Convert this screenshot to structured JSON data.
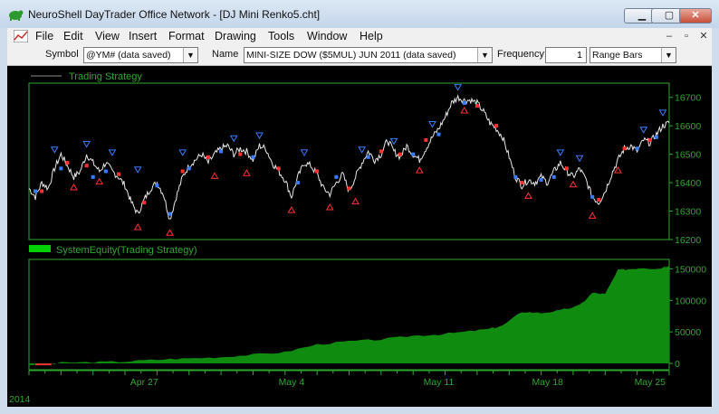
{
  "window": {
    "title": "NeuroShell DayTrader Office Network - [DJ Mini Renko5.cht]",
    "minimize": "▁",
    "maximize": "▢",
    "close": "✕"
  },
  "menu": {
    "items": [
      "File",
      "Edit",
      "View",
      "Insert",
      "Format",
      "Drawing",
      "Tools",
      "Window",
      "Help"
    ],
    "mdi_minimize": "–",
    "mdi_restore": "▫",
    "mdi_close": "✕"
  },
  "toolbar": {
    "symbol_label": "Symbol",
    "symbol_value": "@YM# (data saved)",
    "name_label": "Name",
    "name_value": "MINI-SIZE DOW ($5MUL) JUN 2011 (data saved)",
    "frequency_label": "Frequency",
    "frequency_value": "1",
    "range_value": "Range Bars"
  },
  "colors": {
    "price_line": "#e6e6e6",
    "axis": "#2fa62f",
    "equity_fill": "#0f8c0f",
    "equity_legend": "#00d000",
    "buy_marker": "#3a7cff",
    "sell_marker": "#ff3030",
    "background": "#000000"
  },
  "chart_data": [
    {
      "type": "line",
      "title": "Trading Strategy",
      "legend_position": "top-left",
      "ylim": [
        16200,
        16750
      ],
      "y_ticks": [
        16200,
        16300,
        16400,
        16500,
        16600,
        16700
      ],
      "x_tick_labels": [
        "Apr 27",
        "May 4",
        "May 11",
        "May 18",
        "May 25"
      ],
      "x_tick_positions": [
        0.18,
        0.41,
        0.64,
        0.81,
        0.97
      ],
      "series": [
        {
          "name": "Trading Strategy",
          "points": [
            [
              0,
              16380
            ],
            [
              0.01,
              16350
            ],
            [
              0.02,
              16400
            ],
            [
              0.03,
              16380
            ],
            [
              0.04,
              16450
            ],
            [
              0.05,
              16500
            ],
            [
              0.06,
              16460
            ],
            [
              0.07,
              16420
            ],
            [
              0.08,
              16440
            ],
            [
              0.09,
              16500
            ],
            [
              0.1,
              16470
            ],
            [
              0.11,
              16440
            ],
            [
              0.12,
              16470
            ],
            [
              0.13,
              16440
            ],
            [
              0.14,
              16420
            ],
            [
              0.15,
              16390
            ],
            [
              0.16,
              16330
            ],
            [
              0.17,
              16290
            ],
            [
              0.18,
              16340
            ],
            [
              0.19,
              16380
            ],
            [
              0.2,
              16400
            ],
            [
              0.21,
              16360
            ],
            [
              0.22,
              16270
            ],
            [
              0.23,
              16350
            ],
            [
              0.24,
              16420
            ],
            [
              0.25,
              16460
            ],
            [
              0.26,
              16480
            ],
            [
              0.27,
              16500
            ],
            [
              0.28,
              16470
            ],
            [
              0.29,
              16500
            ],
            [
              0.3,
              16520
            ],
            [
              0.31,
              16530
            ],
            [
              0.32,
              16500
            ],
            [
              0.33,
              16520
            ],
            [
              0.34,
              16510
            ],
            [
              0.35,
              16480
            ],
            [
              0.36,
              16530
            ],
            [
              0.37,
              16520
            ],
            [
              0.38,
              16470
            ],
            [
              0.39,
              16440
            ],
            [
              0.4,
              16410
            ],
            [
              0.41,
              16350
            ],
            [
              0.42,
              16420
            ],
            [
              0.43,
              16470
            ],
            [
              0.44,
              16460
            ],
            [
              0.45,
              16430
            ],
            [
              0.46,
              16380
            ],
            [
              0.47,
              16360
            ],
            [
              0.48,
              16400
            ],
            [
              0.49,
              16430
            ],
            [
              0.5,
              16370
            ],
            [
              0.51,
              16420
            ],
            [
              0.52,
              16470
            ],
            [
              0.53,
              16510
            ],
            [
              0.54,
              16480
            ],
            [
              0.55,
              16500
            ],
            [
              0.56,
              16550
            ],
            [
              0.57,
              16510
            ],
            [
              0.58,
              16490
            ],
            [
              0.59,
              16530
            ],
            [
              0.6,
              16500
            ],
            [
              0.61,
              16480
            ],
            [
              0.62,
              16520
            ],
            [
              0.63,
              16560
            ],
            [
              0.64,
              16590
            ],
            [
              0.65,
              16630
            ],
            [
              0.66,
              16680
            ],
            [
              0.67,
              16700
            ],
            [
              0.68,
              16690
            ],
            [
              0.69,
              16690
            ],
            [
              0.7,
              16680
            ],
            [
              0.71,
              16650
            ],
            [
              0.72,
              16610
            ],
            [
              0.73,
              16590
            ],
            [
              0.74,
              16560
            ],
            [
              0.75,
              16490
            ],
            [
              0.76,
              16420
            ],
            [
              0.77,
              16390
            ],
            [
              0.78,
              16410
            ],
            [
              0.79,
              16400
            ],
            [
              0.8,
              16420
            ],
            [
              0.81,
              16400
            ],
            [
              0.82,
              16440
            ],
            [
              0.83,
              16470
            ],
            [
              0.84,
              16440
            ],
            [
              0.85,
              16420
            ],
            [
              0.86,
              16450
            ],
            [
              0.87,
              16410
            ],
            [
              0.88,
              16350
            ],
            [
              0.89,
              16330
            ],
            [
              0.9,
              16370
            ],
            [
              0.91,
              16430
            ],
            [
              0.92,
              16480
            ],
            [
              0.93,
              16520
            ],
            [
              0.94,
              16530
            ],
            [
              0.95,
              16510
            ],
            [
              0.96,
              16550
            ],
            [
              0.97,
              16540
            ],
            [
              0.98,
              16570
            ],
            [
              0.99,
              16600
            ],
            [
              1,
              16610
            ]
          ]
        }
      ],
      "buy_markers": [
        [
          0.01,
          16370
        ],
        [
          0.05,
          16450
        ],
        [
          0.1,
          16420
        ],
        [
          0.12,
          16440
        ],
        [
          0.2,
          16390
        ],
        [
          0.22,
          16290
        ],
        [
          0.25,
          16450
        ],
        [
          0.3,
          16510
        ],
        [
          0.35,
          16490
        ],
        [
          0.42,
          16400
        ],
        [
          0.48,
          16420
        ],
        [
          0.53,
          16490
        ],
        [
          0.6,
          16500
        ],
        [
          0.64,
          16570
        ],
        [
          0.68,
          16680
        ],
        [
          0.76,
          16420
        ],
        [
          0.8,
          16410
        ],
        [
          0.82,
          16420
        ],
        [
          0.88,
          16350
        ],
        [
          0.95,
          16520
        ],
        [
          0.98,
          16560
        ]
      ],
      "sell_markers": [
        [
          0.02,
          16370
        ],
        [
          0.06,
          16470
        ],
        [
          0.09,
          16460
        ],
        [
          0.14,
          16430
        ],
        [
          0.18,
          16330
        ],
        [
          0.24,
          16440
        ],
        [
          0.28,
          16490
        ],
        [
          0.33,
          16500
        ],
        [
          0.39,
          16450
        ],
        [
          0.45,
          16440
        ],
        [
          0.5,
          16380
        ],
        [
          0.55,
          16510
        ],
        [
          0.58,
          16500
        ],
        [
          0.62,
          16550
        ],
        [
          0.7,
          16670
        ],
        [
          0.73,
          16600
        ],
        [
          0.77,
          16400
        ],
        [
          0.84,
          16450
        ],
        [
          0.89,
          16340
        ],
        [
          0.93,
          16520
        ],
        [
          0.97,
          16550
        ]
      ],
      "down_triangles": [
        [
          0.04,
          16490
        ],
        [
          0.09,
          16510
        ],
        [
          0.13,
          16480
        ],
        [
          0.17,
          16420
        ],
        [
          0.24,
          16480
        ],
        [
          0.32,
          16530
        ],
        [
          0.36,
          16540
        ],
        [
          0.43,
          16480
        ],
        [
          0.52,
          16490
        ],
        [
          0.57,
          16520
        ],
        [
          0.63,
          16580
        ],
        [
          0.67,
          16710
        ],
        [
          0.83,
          16480
        ],
        [
          0.86,
          16460
        ],
        [
          0.96,
          16560
        ],
        [
          0.99,
          16620
        ]
      ],
      "up_triangles": [
        [
          0.07,
          16410
        ],
        [
          0.11,
          16430
        ],
        [
          0.17,
          16270
        ],
        [
          0.22,
          16250
        ],
        [
          0.29,
          16450
        ],
        [
          0.34,
          16460
        ],
        [
          0.41,
          16330
        ],
        [
          0.47,
          16340
        ],
        [
          0.51,
          16360
        ],
        [
          0.61,
          16470
        ],
        [
          0.68,
          16680
        ],
        [
          0.78,
          16380
        ],
        [
          0.85,
          16420
        ],
        [
          0.88,
          16310
        ],
        [
          0.92,
          16470
        ]
      ]
    },
    {
      "type": "area",
      "title": "SystemEquity(Trading Strategy)",
      "legend_position": "top-left",
      "ylim": [
        -10000,
        165000
      ],
      "y_ticks": [
        0,
        50000,
        100000,
        150000
      ],
      "series": [
        {
          "name": "SystemEquity(Trading Strategy)",
          "points": [
            [
              0,
              -2000
            ],
            [
              0.03,
              -2000
            ],
            [
              0.05,
              1000
            ],
            [
              0.1,
              2000
            ],
            [
              0.15,
              3000
            ],
            [
              0.2,
              6000
            ],
            [
              0.25,
              8000
            ],
            [
              0.3,
              10000
            ],
            [
              0.35,
              14000
            ],
            [
              0.4,
              18000
            ],
            [
              0.45,
              30000
            ],
            [
              0.5,
              35000
            ],
            [
              0.55,
              38000
            ],
            [
              0.6,
              44000
            ],
            [
              0.64,
              46000
            ],
            [
              0.68,
              50000
            ],
            [
              0.72,
              55000
            ],
            [
              0.74,
              60000
            ],
            [
              0.77,
              82000
            ],
            [
              0.8,
              80000
            ],
            [
              0.83,
              84000
            ],
            [
              0.86,
              92000
            ],
            [
              0.88,
              112000
            ],
            [
              0.9,
              110000
            ],
            [
              0.92,
              148000
            ],
            [
              0.94,
              150000
            ],
            [
              0.96,
              152000
            ],
            [
              0.98,
              150000
            ],
            [
              1,
              155000
            ]
          ]
        }
      ]
    }
  ],
  "footer": {
    "year_label": "2014"
  }
}
